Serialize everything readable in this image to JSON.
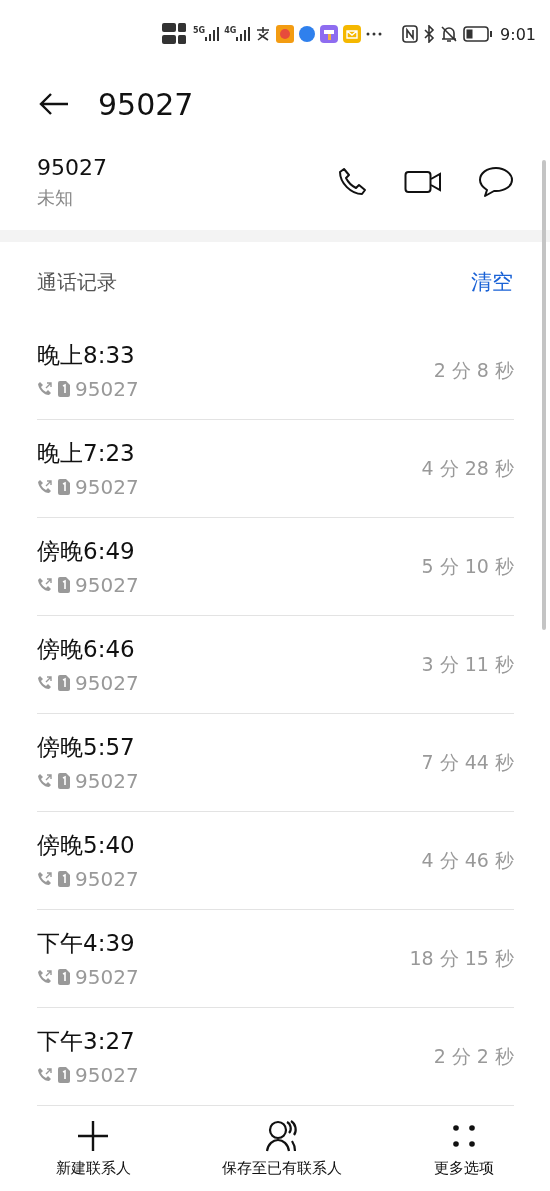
{
  "status_bar": {
    "network": [
      "5G",
      "4G"
    ],
    "time": "9:01"
  },
  "header": {
    "title": "95027"
  },
  "contact": {
    "number": "95027",
    "label": "未知"
  },
  "call_log": {
    "title": "通话记录",
    "clear": "清空",
    "rows": [
      {
        "time": "晚上8:33",
        "number": "95027",
        "duration": "2 分 8 秒"
      },
      {
        "time": "晚上7:23",
        "number": "95027",
        "duration": "4 分 28 秒"
      },
      {
        "time": "傍晚6:49",
        "number": "95027",
        "duration": "5 分 10 秒"
      },
      {
        "time": "傍晚6:46",
        "number": "95027",
        "duration": "3 分 11 秒"
      },
      {
        "time": "傍晚5:57",
        "number": "95027",
        "duration": "7 分 44 秒"
      },
      {
        "time": "傍晚5:40",
        "number": "95027",
        "duration": "4 分 46 秒"
      },
      {
        "time": "下午4:39",
        "number": "95027",
        "duration": "18 分 15 秒"
      },
      {
        "time": "下午3:27",
        "number": "95027",
        "duration": "2 分 2 秒"
      }
    ]
  },
  "bottom_bar": [
    {
      "kind": "add",
      "label": "新建联系人"
    },
    {
      "kind": "person",
      "label": "保存至已有联系人"
    },
    {
      "kind": "more",
      "label": "更多选项"
    }
  ]
}
